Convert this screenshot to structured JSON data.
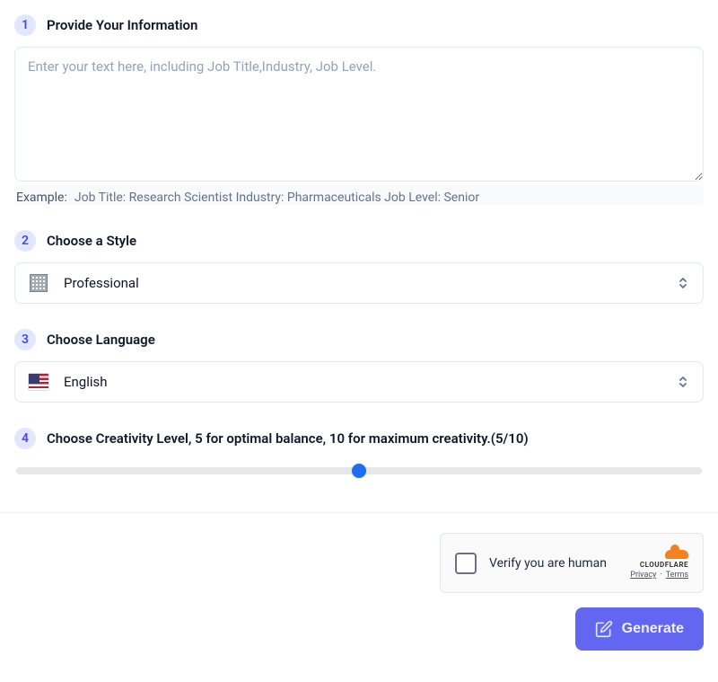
{
  "steps": [
    {
      "num": "1",
      "title": "Provide Your Information",
      "textarea_placeholder": "Enter your text here, including Job Title,Industry, Job Level.",
      "example_label": "Example:",
      "example_text": "Job Title: Research Scientist Industry: Pharmaceuticals Job Level: Senior"
    },
    {
      "num": "2",
      "title": "Choose a Style",
      "icon_name": "building-icon",
      "selected": "Professional"
    },
    {
      "num": "3",
      "title": "Choose Language",
      "icon_name": "flag-us-icon",
      "selected": "English"
    },
    {
      "num": "4",
      "title": "Choose Creativity Level, 5 for optimal balance, 10 for maximum creativity.(5/10)",
      "slider": {
        "min": 0,
        "max": 10,
        "value": 5
      }
    }
  ],
  "captcha": {
    "label": "Verify you are human",
    "brand": "CLOUDFLARE",
    "privacy": "Privacy",
    "terms": "Terms"
  },
  "generate_label": "Generate"
}
